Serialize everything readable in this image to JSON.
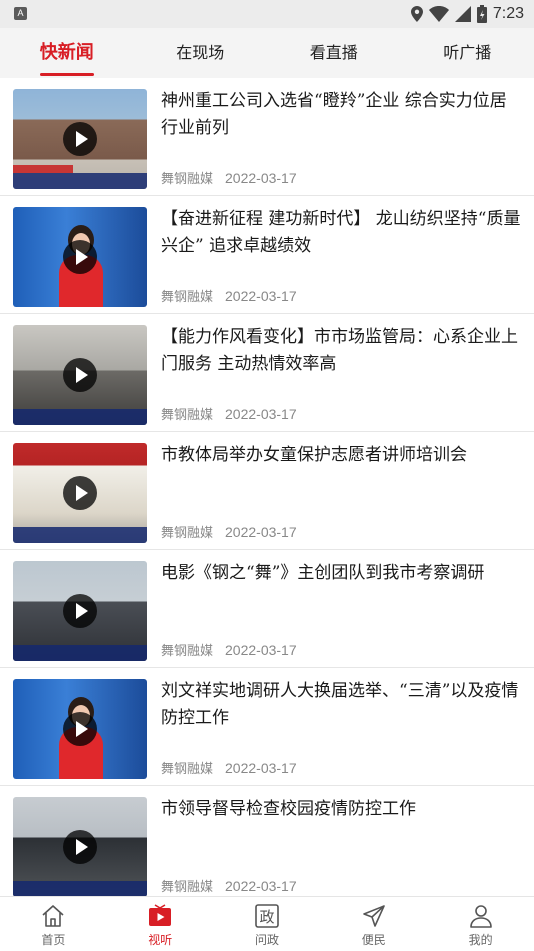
{
  "status_bar": {
    "time": "7:23",
    "notification_letter": "A"
  },
  "tabs": [
    {
      "label": "快新闻",
      "active": true
    },
    {
      "label": "在现场",
      "active": false
    },
    {
      "label": "看直播",
      "active": false
    },
    {
      "label": "听广播",
      "active": false
    }
  ],
  "news": [
    {
      "title": "神州重工公司入选省“瞪羚”企业 综合实力位居行业前列",
      "source": "舞钢融媒",
      "date": "2022-03-17"
    },
    {
      "title": "【奋进新征程 建功新时代】 龙山纺织坚持“质量兴企” 追求卓越绩效",
      "source": "舞钢融媒",
      "date": "2022-03-17"
    },
    {
      "title": "【能力作风看变化】市市场监管局：心系企业上门服务 主动热情效率高",
      "source": "舞钢融媒",
      "date": "2022-03-17"
    },
    {
      "title": "市教体局举办女童保护志愿者讲师培训会",
      "source": "舞钢融媒",
      "date": "2022-03-17"
    },
    {
      "title": "电影《钢之“舞”》主创团队到我市考察调研",
      "source": "舞钢融媒",
      "date": "2022-03-17"
    },
    {
      "title": "刘文祥实地调研人大换届选举、“三清”以及疫情防控工作",
      "source": "舞钢融媒",
      "date": "2022-03-17"
    },
    {
      "title": "市领导督导检查校园疫情防控工作",
      "source": "舞钢融媒",
      "date": "2022-03-17"
    }
  ],
  "bottom_nav": [
    {
      "label": "首页",
      "icon": "home-icon",
      "active": false
    },
    {
      "label": "视听",
      "icon": "video-icon",
      "active": true
    },
    {
      "label": "问政",
      "icon": "politics-icon",
      "active": false
    },
    {
      "label": "便民",
      "icon": "send-icon",
      "active": false
    },
    {
      "label": "我的",
      "icon": "user-icon",
      "active": false
    }
  ],
  "colors": {
    "accent": "#d81e25",
    "text": "#1a1a1a",
    "meta": "#888888"
  }
}
